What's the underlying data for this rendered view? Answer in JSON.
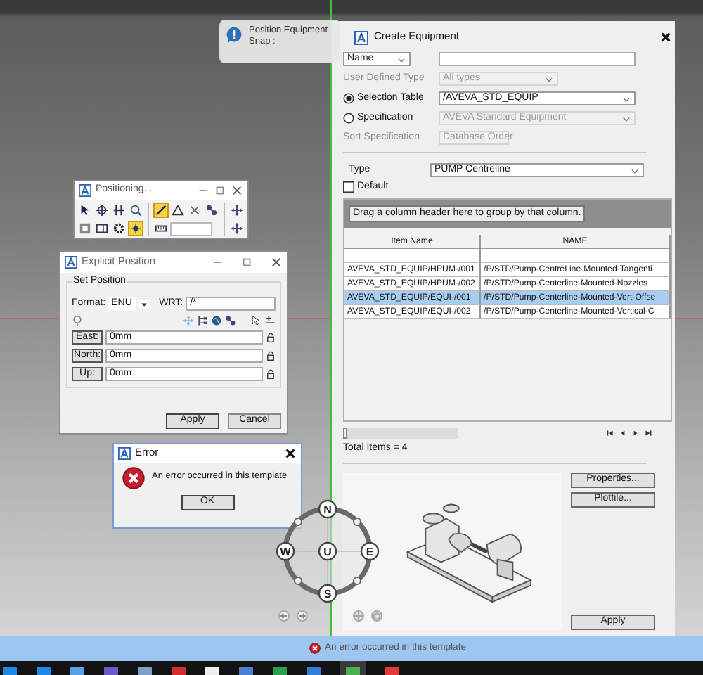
{
  "tooltip": {
    "title": "Position Equipment",
    "text": "Snap :"
  },
  "positioning_toolbar": {
    "title": "Positioning...",
    "tools": [
      {
        "kind": "pointer",
        "on": false
      },
      {
        "kind": "target",
        "on": false
      },
      {
        "kind": "bars",
        "on": false
      },
      {
        "kind": "zoom",
        "on": false
      },
      {
        "kind": "block",
        "on": false
      },
      {
        "kind": "window",
        "on": false
      },
      {
        "kind": "gear",
        "on": false
      },
      {
        "kind": "point",
        "on": true
      },
      {
        "kind": "line",
        "on": true
      },
      {
        "kind": "triangle",
        "on": false
      },
      {
        "kind": "cross",
        "on": false
      },
      {
        "kind": "nodes",
        "on": false
      },
      {
        "kind": "ruler",
        "on": false
      },
      {
        "kind": "move",
        "on": false
      },
      {
        "kind": "move",
        "on": false
      }
    ]
  },
  "explicit_position": {
    "title": "Explicit Position",
    "group": "Set Position",
    "format_label": "Format:",
    "format_value": "ENU",
    "wrt_label": "WRT:",
    "wrt_value": "/*",
    "coordinates": [
      {
        "label": "East:",
        "value": "0mm"
      },
      {
        "label": "North:",
        "value": "0mm"
      },
      {
        "label": "Up:",
        "value": "0mm"
      }
    ],
    "buttons": [
      "Apply",
      "Cancel"
    ]
  },
  "error_dialog": {
    "title": "Error",
    "message": "An error occurred in this template",
    "button": "OK"
  },
  "compass": {
    "directions": [
      "N",
      "W",
      "U",
      "E",
      "S"
    ]
  },
  "create_equipment": {
    "title": "Create Equipment",
    "name_filter": "Name",
    "criteria": [
      {
        "kind": "label",
        "label": "User Defined Type",
        "value": "All types",
        "disabled": true
      },
      {
        "kind": "radio",
        "label": "Selection Table",
        "selected": true,
        "value": "/AVEVA_STD_EQUIP",
        "disabled": false
      },
      {
        "kind": "radio",
        "label": "Specification",
        "selected": false,
        "value": "AVEVA Standard Equipment",
        "disabled": true
      },
      {
        "kind": "label",
        "label": "Sort Specification",
        "value": "Database Order",
        "disabled": true
      }
    ],
    "type": {
      "label": "Type",
      "value": "PUMP Centreline"
    },
    "default": {
      "label": "Default",
      "checked": false
    },
    "group_hint": "Drag a column header here to group by that column.",
    "table": {
      "columns": [
        "Item Name",
        "NAME"
      ],
      "rows": [
        {
          "cells": [
            "AVEVA_STD_EQUIP/HPUM-/001",
            "/P/STD/Pump-CentreLine-Mounted-Tangenti"
          ],
          "selected": false
        },
        {
          "cells": [
            "AVEVA_STD_EQUIP/HPUM-/002",
            "/P/STD/Pump-Centerline-Mounted-Nozzles"
          ],
          "selected": false
        },
        {
          "cells": [
            "AVEVA_STD_EQUIP/EQUI-/001",
            "/P/STD/Pump-Centerline-Mounted-Vert-Offse"
          ],
          "selected": true
        },
        {
          "cells": [
            "AVEVA_STD_EQUIP/EQUI-/002",
            "/P/STD/Pump-Centerline-Mounted-Vertical-C"
          ],
          "selected": false
        }
      ]
    },
    "total": "Total Items = 4",
    "buttons": [
      "Properties...",
      "Plotfile...",
      "Apply"
    ]
  },
  "status_bar": {
    "message": "An error occurred in this template"
  }
}
